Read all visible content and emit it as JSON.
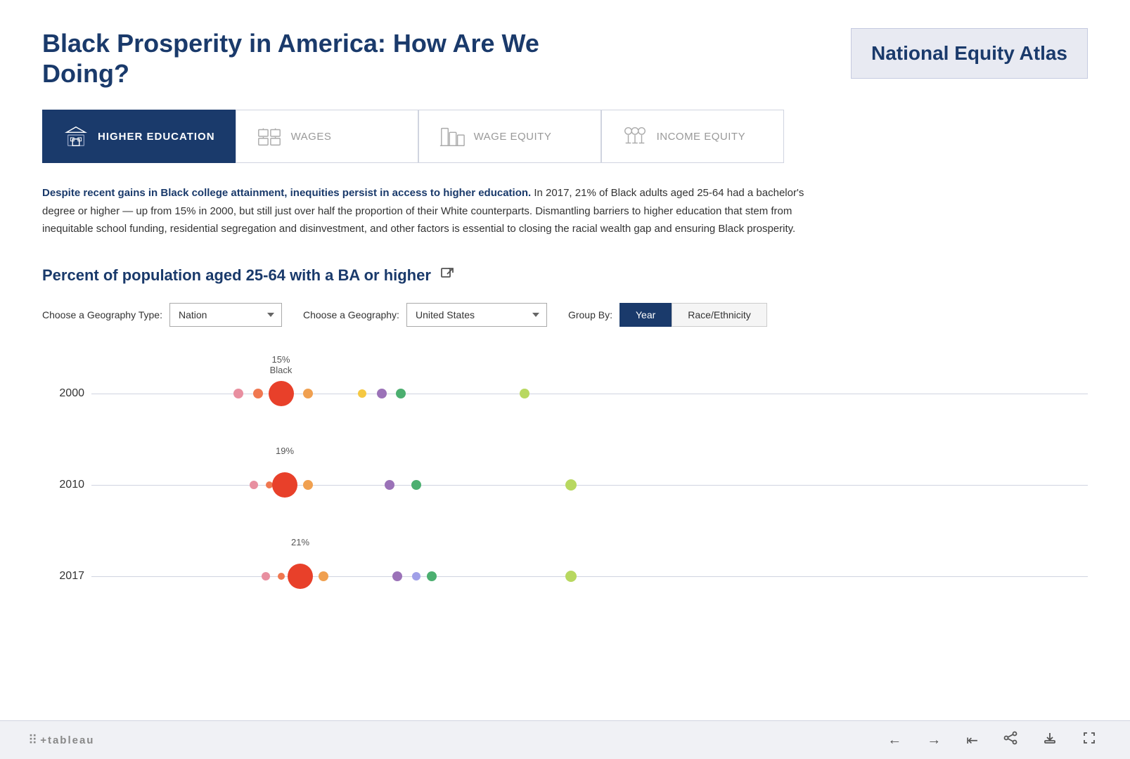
{
  "header": {
    "title": "Black Prosperity in America: How Are We Doing?",
    "brand": {
      "title": "National Equity Atlas"
    }
  },
  "tabs": [
    {
      "id": "higher-education",
      "label": "HIGHER EDUCATION",
      "active": true
    },
    {
      "id": "wages",
      "label": "WAGES",
      "active": false
    },
    {
      "id": "wage-equity",
      "label": "WAGE EQUITY",
      "active": false
    },
    {
      "id": "income-equity",
      "label": "INCOME EQUITY",
      "active": false
    }
  ],
  "description": {
    "bold_text": "Despite recent gains in Black college attainment, inequities persist in access to higher education.",
    "body_text": " In 2017, 21% of Black adults aged 25-64 had a bachelor's degree or higher — up from 15% in 2000, but still just over half the proportion of their White counterparts. Dismantling barriers to higher education that stem from inequitable school funding, residential segregation and disinvestment, and other factors is essential to closing the racial wealth gap and ensuring Black prosperity."
  },
  "chart": {
    "title": "Percent of population aged 25-64 with a BA or higher",
    "geography_type_label": "Choose a Geography Type:",
    "geography_type_value": "Nation",
    "geography_label": "Choose a Geography:",
    "geography_value": "United States",
    "group_by_label": "Group By:",
    "group_by_options": [
      "Year",
      "Race/Ethnicity"
    ],
    "group_by_active": "Year",
    "rows": [
      {
        "year": "2000",
        "tooltip_pct": "15%",
        "tooltip_label": "Black",
        "dots": [
          {
            "color": "#e88fa0",
            "size": 14,
            "left_pct": 19
          },
          {
            "color": "#f07850",
            "size": 14,
            "left_pct": 21.5
          },
          {
            "color": "#e8402a",
            "size": 36,
            "left_pct": 24.5
          },
          {
            "color": "#f0a050",
            "size": 14,
            "left_pct": 28
          },
          {
            "color": "#f5c842",
            "size": 12,
            "left_pct": 35
          },
          {
            "color": "#9b72b8",
            "size": 14,
            "left_pct": 37.5
          },
          {
            "color": "#4caf70",
            "size": 14,
            "left_pct": 40
          },
          {
            "color": "#b8d860",
            "size": 14,
            "left_pct": 56
          }
        ]
      },
      {
        "year": "2010",
        "tooltip_pct": "19%",
        "tooltip_label": null,
        "dots": [
          {
            "color": "#e88fa0",
            "size": 12,
            "left_pct": 21
          },
          {
            "color": "#f07850",
            "size": 10,
            "left_pct": 23
          },
          {
            "color": "#e8402a",
            "size": 36,
            "left_pct": 25
          },
          {
            "color": "#f0a050",
            "size": 14,
            "left_pct": 28
          },
          {
            "color": "#9b72b8",
            "size": 14,
            "left_pct": 38.5
          },
          {
            "color": "#4caf70",
            "size": 14,
            "left_pct": 42
          },
          {
            "color": "#b8d860",
            "size": 16,
            "left_pct": 62
          }
        ]
      },
      {
        "year": "2017",
        "tooltip_pct": "21%",
        "tooltip_label": null,
        "dots": [
          {
            "color": "#e88fa0",
            "size": 12,
            "left_pct": 22.5
          },
          {
            "color": "#f07850",
            "size": 10,
            "left_pct": 24.5
          },
          {
            "color": "#e8402a",
            "size": 36,
            "left_pct": 27
          },
          {
            "color": "#f0a050",
            "size": 14,
            "left_pct": 30
          },
          {
            "color": "#9b72b8",
            "size": 14,
            "left_pct": 39.5
          },
          {
            "color": "#a0a0e8",
            "size": 12,
            "left_pct": 42
          },
          {
            "color": "#4caf70",
            "size": 14,
            "left_pct": 44
          },
          {
            "color": "#b8d860",
            "size": 16,
            "left_pct": 62
          }
        ]
      }
    ]
  },
  "footer": {
    "logo_text": "+ a b l e a u",
    "nav_buttons": [
      "←",
      "→",
      "|←",
      "share",
      "download",
      "fullscreen"
    ]
  }
}
